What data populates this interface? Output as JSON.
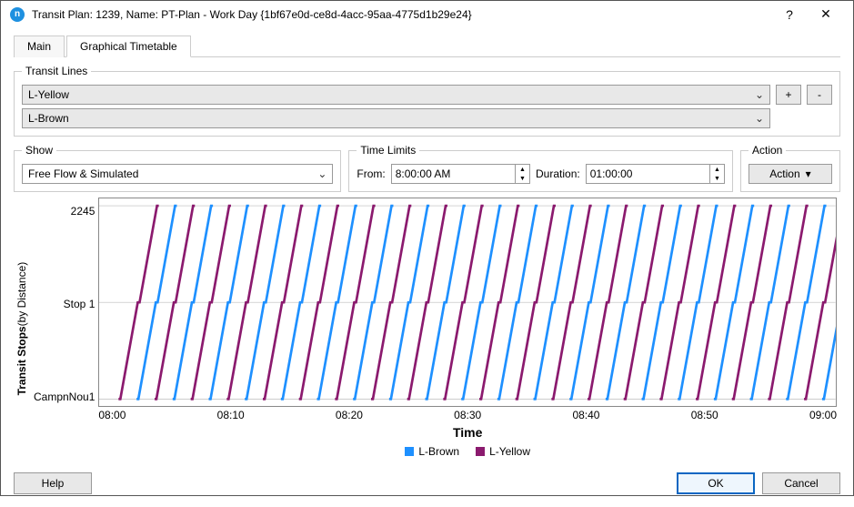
{
  "window": {
    "title": "Transit Plan: 1239, Name: PT-Plan - Work Day  {1bf67e0d-ce8d-4acc-95aa-4775d1b29e24}",
    "help_icon": "?",
    "close_icon": "✕"
  },
  "tabs": {
    "main": "Main",
    "graphical": "Graphical Timetable",
    "active": "graphical"
  },
  "transit_lines": {
    "legend": "Transit Lines",
    "lines": [
      "L-Yellow",
      "L-Brown"
    ],
    "add": "+",
    "remove": "-"
  },
  "show": {
    "legend": "Show",
    "value": "Free Flow & Simulated"
  },
  "time_limits": {
    "legend": "Time Limits",
    "from_label": "From:",
    "from_value": "8:00:00 AM",
    "duration_label": "Duration:",
    "duration_value": "01:00:00"
  },
  "action": {
    "legend": "Action",
    "label": "Action",
    "caret": "▾"
  },
  "chart": {
    "ylabel_main": "Transit Stops",
    "ylabel_sub": "(by Distance)",
    "yticks": [
      "2245",
      "Stop 1",
      "CampnNou1"
    ],
    "xlabel": "Time",
    "xticks": [
      "08:00",
      "08:10",
      "08:20",
      "08:30",
      "08:40",
      "08:50",
      "09:00"
    ],
    "legend": [
      {
        "name": "L-Brown",
        "color": "#1e90ff"
      },
      {
        "name": "L-Yellow",
        "color": "#8b1a6e"
      }
    ]
  },
  "chart_data": {
    "type": "line",
    "xlabel": "Time",
    "ylabel": "Transit Stops (by Distance)",
    "x_range_minutes": [
      0,
      60
    ],
    "y_stops": [
      "CampnNou1",
      "Stop 1",
      "2245"
    ],
    "series": [
      {
        "name": "L-Yellow",
        "color": "#8b1a6e",
        "headway_min": 3,
        "first_departure_min": 1,
        "stop_offsets_min": [
          0,
          1.6,
          3.2
        ]
      },
      {
        "name": "L-Brown",
        "color": "#1e90ff",
        "headway_min": 3,
        "first_departure_min": 2.5,
        "stop_offsets_min": [
          0,
          1.6,
          3.2
        ]
      }
    ],
    "title": ""
  },
  "footer": {
    "help": "Help",
    "ok": "OK",
    "cancel": "Cancel"
  }
}
